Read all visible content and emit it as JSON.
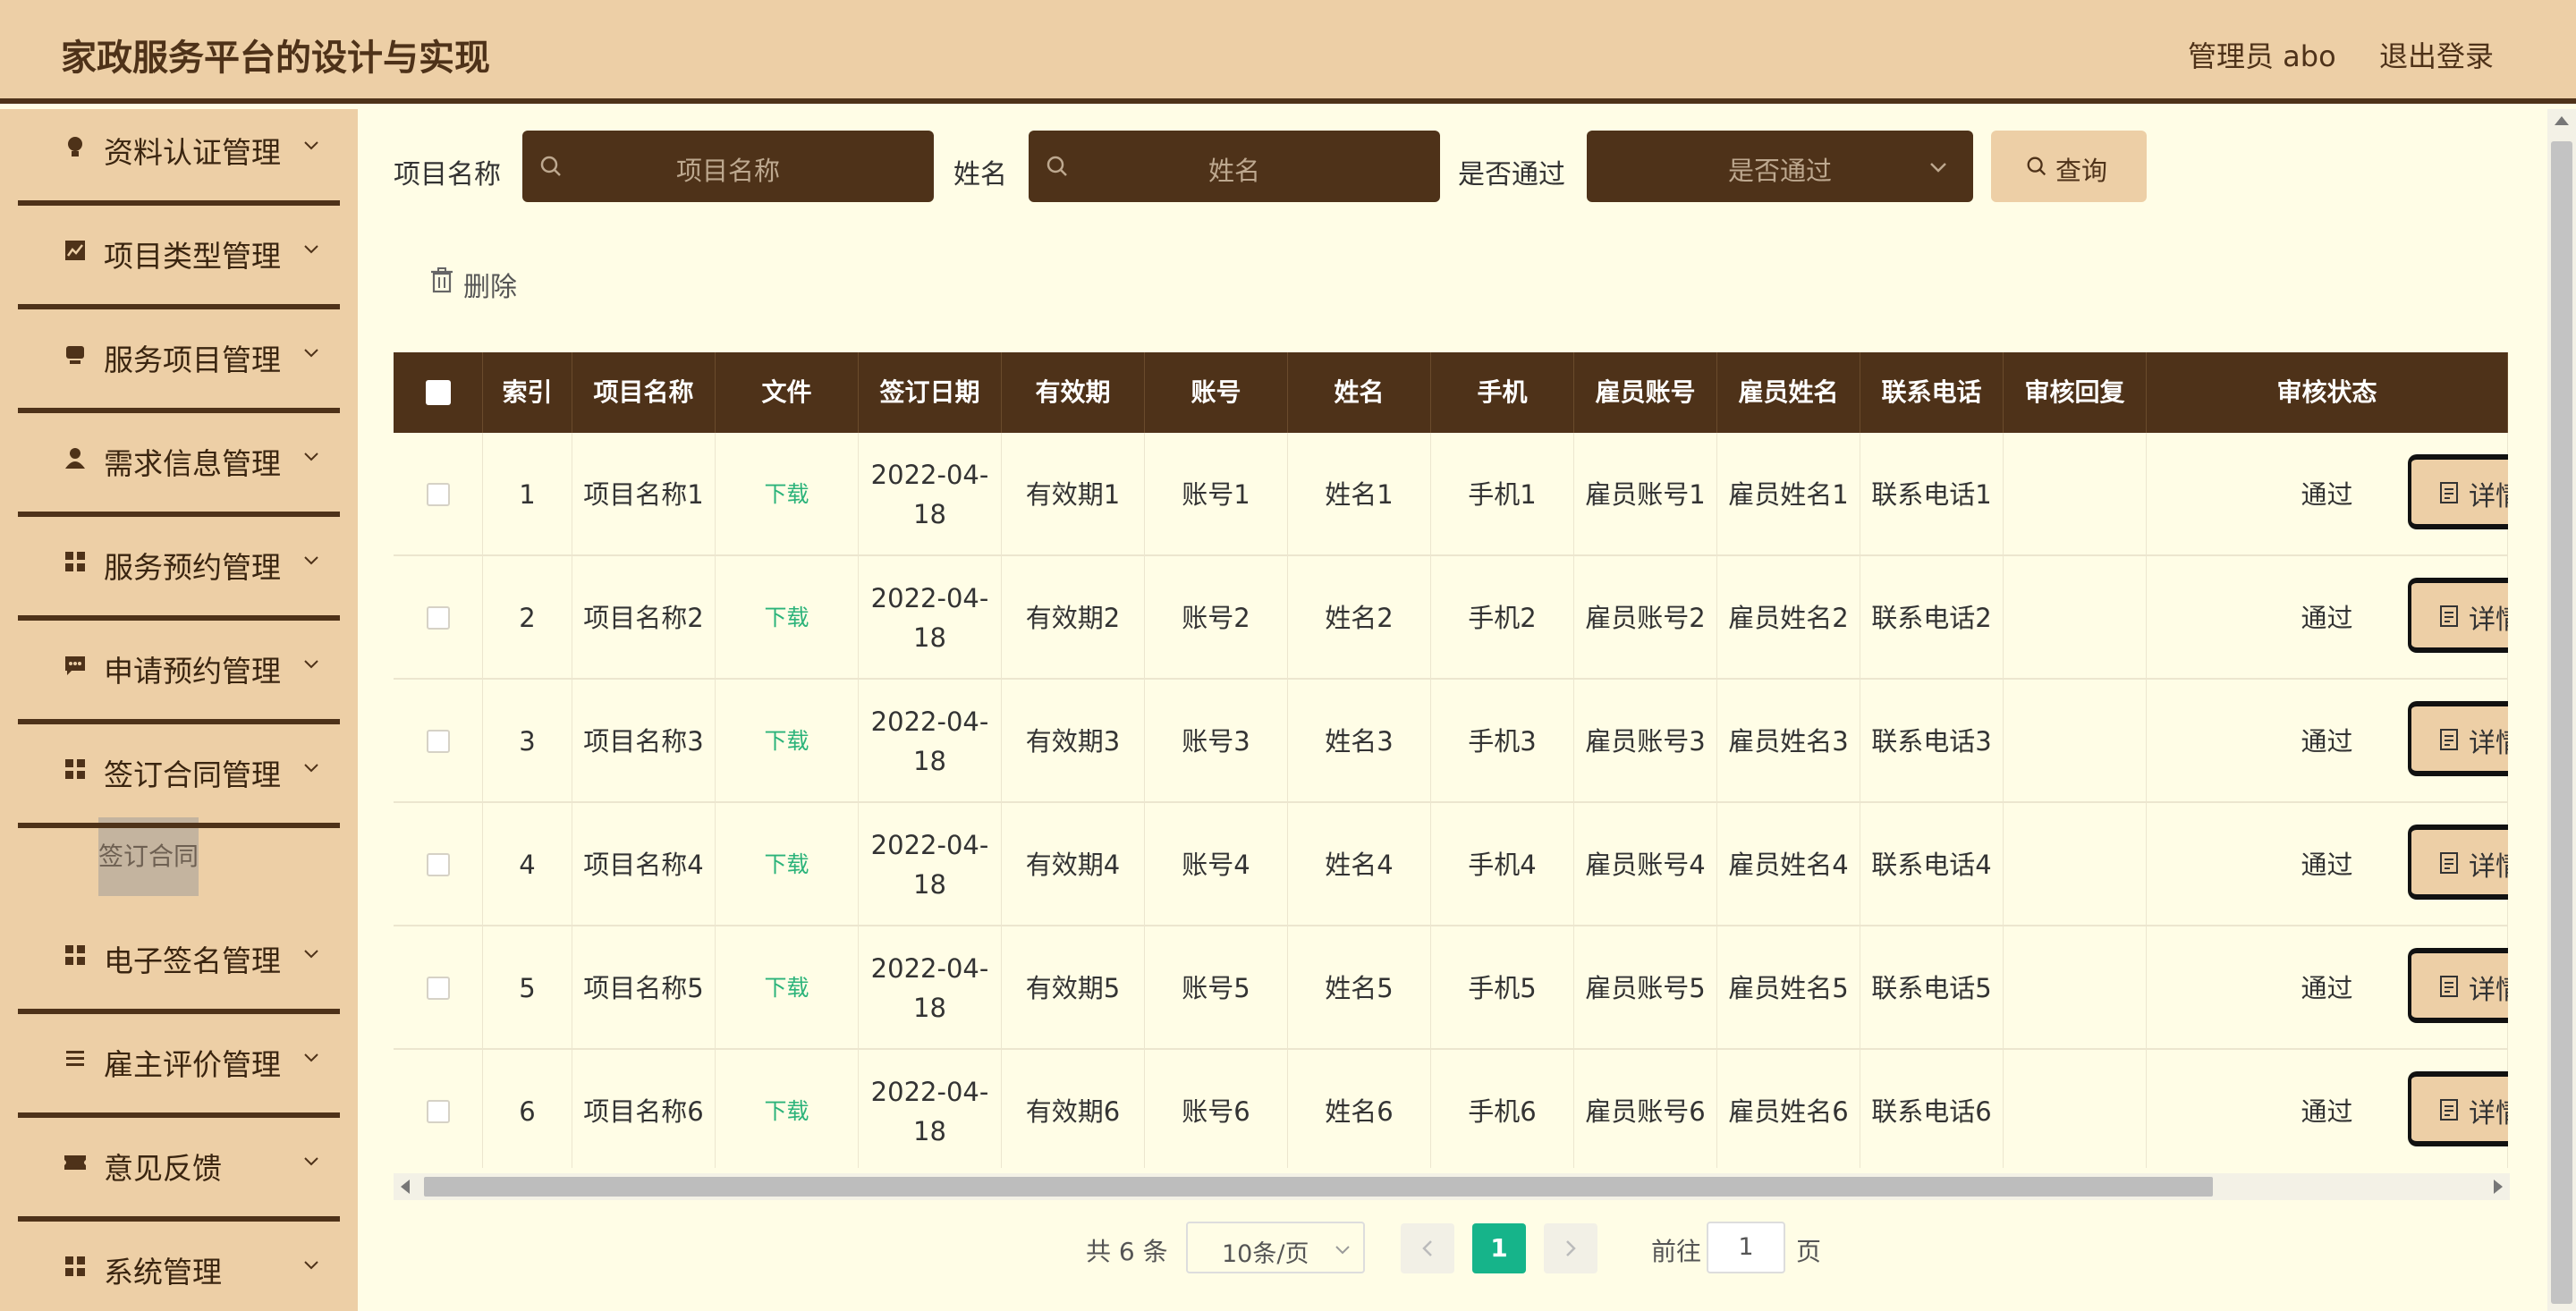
{
  "header": {
    "title": "家政服务平台的设计与实现",
    "user": "管理员 abo",
    "logout": "退出登录"
  },
  "sidebar": {
    "items": [
      {
        "label": "资料认证管理",
        "icon": "bulb-icon"
      },
      {
        "label": "项目类型管理",
        "icon": "chart-icon"
      },
      {
        "label": "服务项目管理",
        "icon": "cup-icon"
      },
      {
        "label": "需求信息管理",
        "icon": "user-icon"
      },
      {
        "label": "服务预约管理",
        "icon": "grid-icon"
      },
      {
        "label": "申请预约管理",
        "icon": "message-icon"
      },
      {
        "label": "签订合同管理",
        "icon": "grid-icon"
      },
      {
        "label": "电子签名管理",
        "icon": "grid-icon"
      },
      {
        "label": "雇主评价管理",
        "icon": "list-icon"
      },
      {
        "label": "意见反馈",
        "icon": "ticket-icon"
      },
      {
        "label": "系统管理",
        "icon": "grid-icon"
      }
    ],
    "active_sub": "签订合同"
  },
  "search": {
    "project_label": "项目名称",
    "project_placeholder": "项目名称",
    "name_label": "姓名",
    "name_placeholder": "姓名",
    "pass_label": "是否通过",
    "pass_placeholder": "是否通过",
    "query": "查询"
  },
  "actions": {
    "delete": "删除"
  },
  "table": {
    "columns": [
      "索引",
      "项目名称",
      "文件",
      "签订日期",
      "有效期",
      "账号",
      "姓名",
      "手机",
      "雇员账号",
      "雇员姓名",
      "联系电话",
      "审核回复",
      "审核状态"
    ],
    "download_label": "下载",
    "detail_label": "详情",
    "rows": [
      {
        "index": "1",
        "project": "项目名称1",
        "date": "2022-04-18",
        "valid": "有效期1",
        "account": "账号1",
        "name": "姓名1",
        "phone": "手机1",
        "emp_account": "雇员账号1",
        "emp_name": "雇员姓名1",
        "tel": "联系电话1",
        "reply": "",
        "status": "通过"
      },
      {
        "index": "2",
        "project": "项目名称2",
        "date": "2022-04-18",
        "valid": "有效期2",
        "account": "账号2",
        "name": "姓名2",
        "phone": "手机2",
        "emp_account": "雇员账号2",
        "emp_name": "雇员姓名2",
        "tel": "联系电话2",
        "reply": "",
        "status": "通过"
      },
      {
        "index": "3",
        "project": "项目名称3",
        "date": "2022-04-18",
        "valid": "有效期3",
        "account": "账号3",
        "name": "姓名3",
        "phone": "手机3",
        "emp_account": "雇员账号3",
        "emp_name": "雇员姓名3",
        "tel": "联系电话3",
        "reply": "",
        "status": "通过"
      },
      {
        "index": "4",
        "project": "项目名称4",
        "date": "2022-04-18",
        "valid": "有效期4",
        "account": "账号4",
        "name": "姓名4",
        "phone": "手机4",
        "emp_account": "雇员账号4",
        "emp_name": "雇员姓名4",
        "tel": "联系电话4",
        "reply": "",
        "status": "通过"
      },
      {
        "index": "5",
        "project": "项目名称5",
        "date": "2022-04-18",
        "valid": "有效期5",
        "account": "账号5",
        "name": "姓名5",
        "phone": "手机5",
        "emp_account": "雇员账号5",
        "emp_name": "雇员姓名5",
        "tel": "联系电话5",
        "reply": "",
        "status": "通过"
      },
      {
        "index": "6",
        "project": "项目名称6",
        "date": "2022-04-18",
        "valid": "有效期6",
        "account": "账号6",
        "name": "姓名6",
        "phone": "手机6",
        "emp_account": "雇员账号6",
        "emp_name": "雇员姓名6",
        "tel": "联系电话6",
        "reply": "",
        "status": "通过"
      }
    ]
  },
  "pagination": {
    "total": "共 6 条",
    "page_size": "10条/页",
    "current": "1",
    "goto": "前往",
    "goto_value": "1",
    "page_suffix": "页"
  },
  "colors": {
    "brand_dark": "#4e3219",
    "brand_light": "#edcfa6",
    "background": "#fffde6",
    "active_page": "#16b48a",
    "download": "#2bb37a"
  }
}
